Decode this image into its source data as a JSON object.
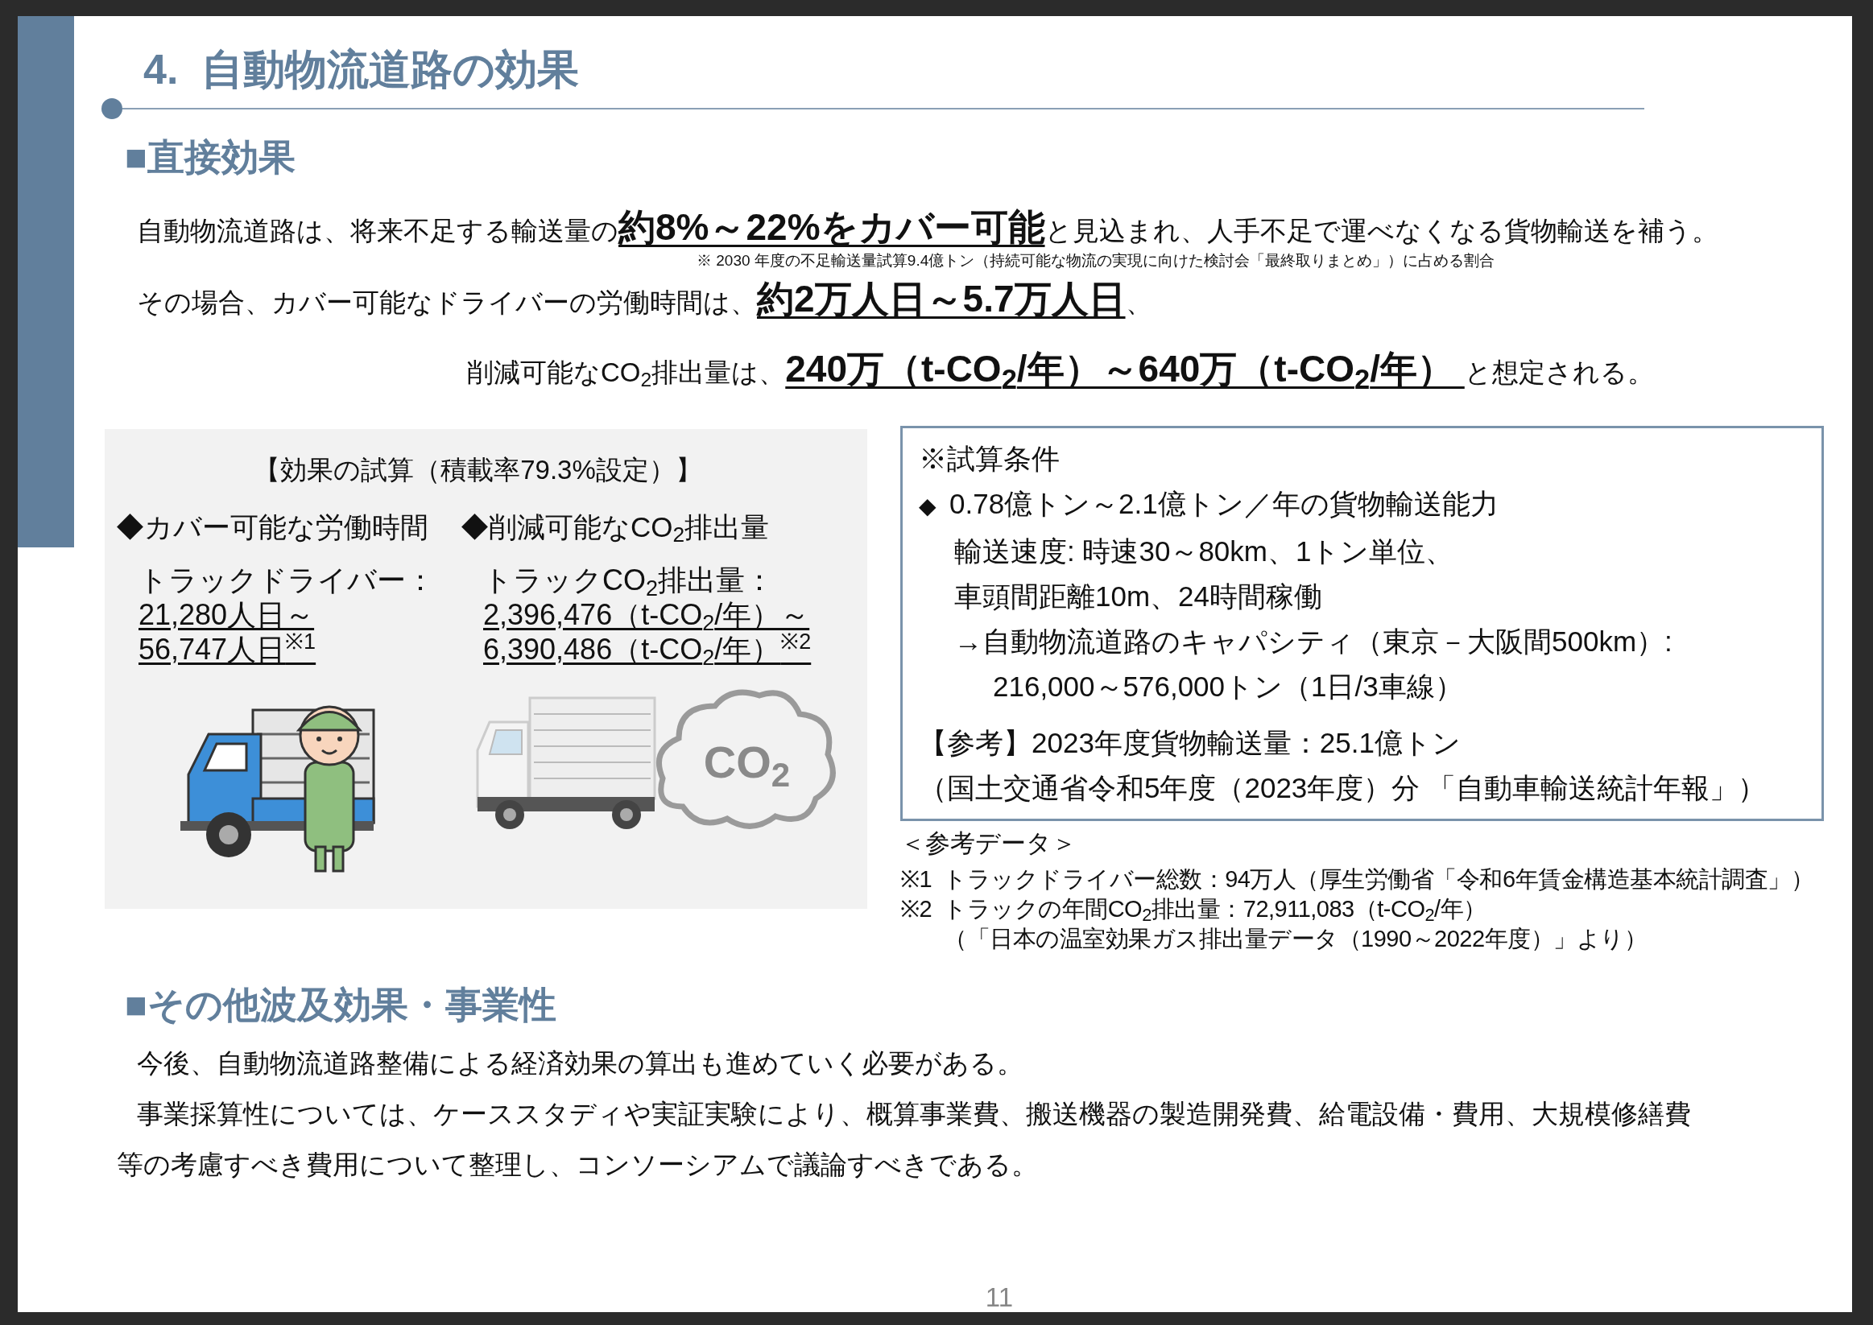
{
  "page": {
    "title": "4.  自動物流道路の効果",
    "page_number": "11"
  },
  "direct_effects": {
    "heading": "■直接効果",
    "lines": [
      {
        "segments": [
          {
            "kind": "plain",
            "text": "自動物流道路は、将来不足する輸送量の"
          },
          {
            "kind": "emphasis",
            "text": "約8%～22%をカバー可能"
          },
          {
            "kind": "plain",
            "text": "と見込まれ、人手不足で運べなくなる貨物輸送を補う。"
          }
        ],
        "note": "※ 2030 年度の不足輸送量試算9.4億トン（持続可能な物流の実現に向けた検討会「最終取りまとめ」）に占める割合"
      },
      {
        "segments": [
          {
            "kind": "plain",
            "text": "その場合、カバー可能なドライバーの労働時間は、"
          },
          {
            "kind": "emphasis",
            "text": "約2万人日～5.7万人日"
          },
          {
            "kind": "plain",
            "text": "、"
          }
        ]
      },
      {
        "segments": [
          {
            "kind": "plain",
            "text": "削減可能なCO$_{2}$排出量は、"
          },
          {
            "kind": "emphasis",
            "text": "240万（t-CO$_{2}$/年）～640万（t-CO$_{2}$/年） "
          },
          {
            "kind": "plain",
            "text": "と想定される。"
          }
        ]
      }
    ]
  },
  "estimate_panel": {
    "caption": "【効果の試算（積載率79.3%設定）】",
    "columns": [
      {
        "kind": "labor",
        "heading": "◆カバー可能な労働時間",
        "label": "トラックドライバー：",
        "values": [
          "21,280人日～",
          "56,747人日$^{※1}$"
        ]
      },
      {
        "kind": "co2",
        "heading": "◆削減可能なCO$_{2}$排出量",
        "label": "トラックCO$_{2}$排出量：",
        "values": [
          "2,396,476（t-CO$_{2}$/年）～",
          "6,390,486（t-CO$_{2}$/年）$^{※2}$"
        ],
        "cloud_label": "CO$_{2}$"
      }
    ]
  },
  "conditions_box": {
    "lines": [
      {
        "kind": "heading",
        "text": "※試算条件"
      },
      {
        "kind": "bullet",
        "marker": "◆",
        "text": "0.78億トン～2.1億トン／年の貨物輸送能力"
      },
      {
        "kind": "indent",
        "text": "輸送速度: 時速30～80km、1トン単位、"
      },
      {
        "kind": "indent",
        "text": "車頭間距離10m、24時間稼働"
      },
      {
        "kind": "indent",
        "text": "→自動物流道路のキャパシティ（東京－大阪間500km）:"
      },
      {
        "kind": "indent2",
        "text": "216,000～576,000トン（1日/3車線）"
      },
      {
        "kind": "reference",
        "text": "【参考】2023年度貨物輸送量：25.1億トン"
      },
      {
        "kind": "source",
        "text": "（国土交通省令和5年度（2023年度）分 「自動車輸送統計年報」）"
      }
    ]
  },
  "reference_data": {
    "heading": "＜参考データ＞",
    "notes": [
      {
        "marker": "※1",
        "text": "トラックドライバー総数：94万人（厚生労働省「令和6年賃金構造基本統計調査」）"
      },
      {
        "marker": "※2",
        "text": "トラックの年間CO$_{2}$排出量：72,911,083（t-CO$_{2}$/年）"
      },
      {
        "text": "（「日本の温室効果ガス排出量データ（1990～2022年度）」より）"
      }
    ]
  },
  "other_effects": {
    "heading": "■その他波及効果・事業性",
    "paragraphs": [
      "今後、自動物流道路整備による経済効果の算出も進めていく必要がある。",
      "事業採算性については、ケーススタディや実証実験により、概算事業費、搬送機器の製造開発費、給電設備・費用、大規模修繕費等の考慮すべき費用について整理し、コンソーシアムで議論すべきである。"
    ]
  }
}
